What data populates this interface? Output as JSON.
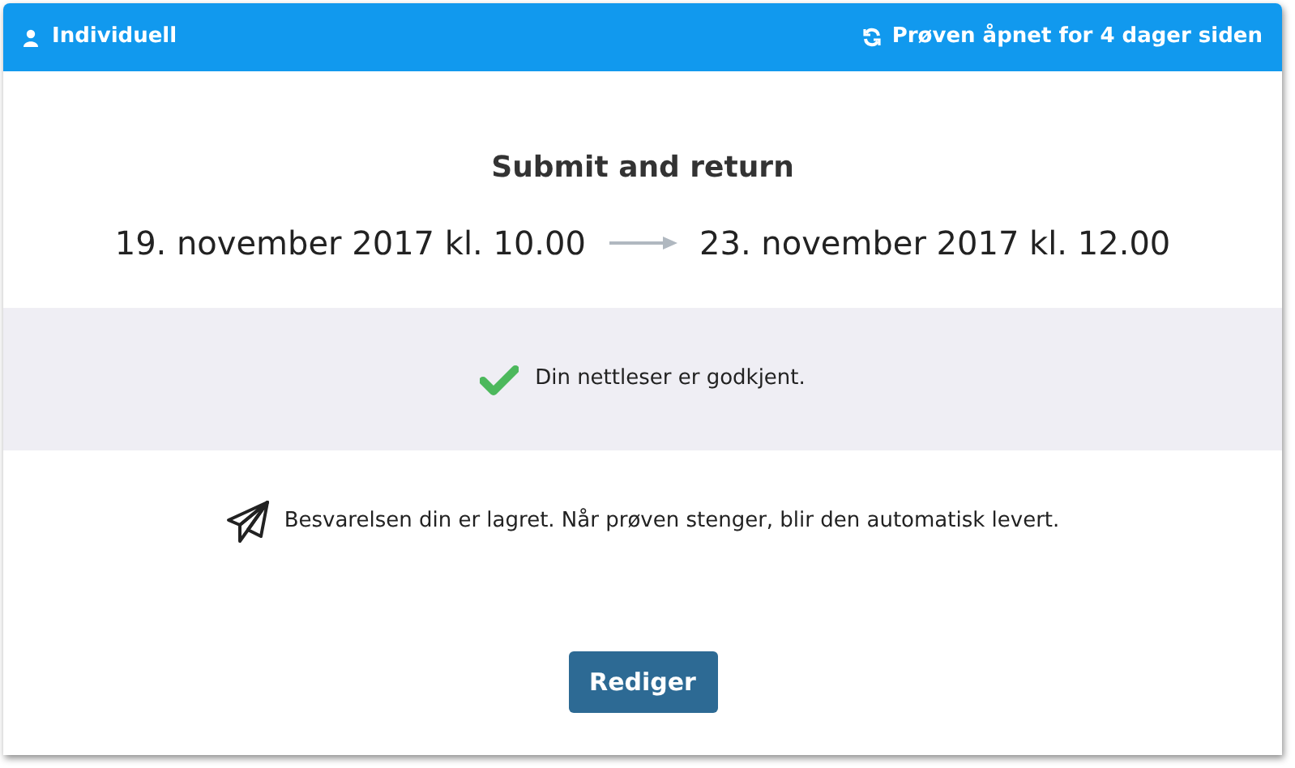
{
  "header": {
    "left_label": "Individuell",
    "right_label": "Prøven åpnet for 4 dager siden"
  },
  "title": "Submit and return",
  "period": {
    "start": "19. november 2017 kl. 10.00",
    "end": "23. november 2017 kl. 12.00"
  },
  "browser_check": {
    "text": "Din nettleser er godkjent.",
    "approved": true
  },
  "status_message": "Besvarelsen din er lagret. Når prøven stenger, blir den automatisk levert.",
  "button": "Rediger"
}
